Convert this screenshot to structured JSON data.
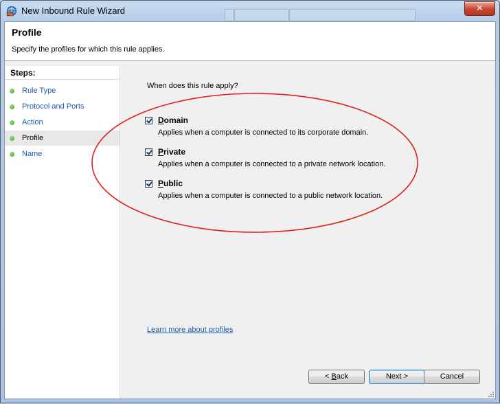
{
  "window": {
    "title": "New Inbound Rule Wizard",
    "close_label": "✕"
  },
  "header": {
    "title": "Profile",
    "description": "Specify the profiles for which this rule applies."
  },
  "steps": {
    "heading": "Steps:",
    "items": [
      {
        "label": "Rule Type"
      },
      {
        "label": "Protocol and Ports"
      },
      {
        "label": "Action"
      },
      {
        "label": "Profile"
      },
      {
        "label": "Name"
      }
    ]
  },
  "main": {
    "question": "When does this rule apply?",
    "options": [
      {
        "accel": "D",
        "rest": "omain",
        "checked": true,
        "description": "Applies when a computer is connected to its corporate domain."
      },
      {
        "accel": "P",
        "rest": "rivate",
        "checked": true,
        "description": "Applies when a computer is connected to a private network location."
      },
      {
        "accel": "P",
        "rest": "ublic",
        "checked": true,
        "description": "Applies when a computer is connected to a public network location."
      }
    ],
    "learn_more": "Learn more about profiles"
  },
  "buttons": {
    "back_prefix": "< ",
    "back_accel": "B",
    "back_rest": "ack",
    "next": "Next >",
    "cancel": "Cancel"
  },
  "colors": {
    "link": "#1a5ca8",
    "annotation_ellipse": "#e0201a",
    "step_dot": "#3a9f1e"
  }
}
